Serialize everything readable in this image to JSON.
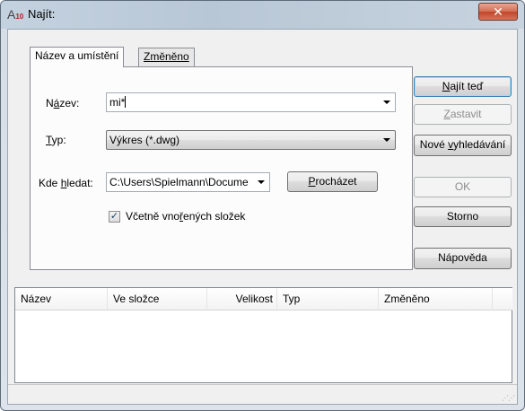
{
  "window": {
    "title": "Najít:",
    "close_glyph": "✕"
  },
  "tabs": [
    {
      "label": "Název a umístění",
      "active": true
    },
    {
      "label": "Změněno",
      "active": false
    }
  ],
  "form": {
    "name_label_pre": "N",
    "name_label_u": "á",
    "name_label_post": "zev:",
    "name_value": "mi*",
    "type_label_u": "T",
    "type_label_post": "yp:",
    "type_value": "Výkres (*.dwg)",
    "lookin_label_pre": "Kde ",
    "lookin_label_u": "h",
    "lookin_label_post": "ledat:",
    "lookin_value": "C:\\Users\\Spielmann\\Docume",
    "browse_u": "P",
    "browse_post": "rocházet",
    "subfolders_pre": "Včetně vno",
    "subfolders_u": "ř",
    "subfolders_post": "ených složek",
    "subfolders_checked": true
  },
  "buttons": {
    "find_u": "N",
    "find_post": "ajít teď",
    "stop_u": "Z",
    "stop_post": "astavit",
    "new_pre": "Nové ",
    "new_u": "v",
    "new_post": "yhledávání",
    "ok": "OK",
    "cancel": "Storno",
    "help": "Nápověda"
  },
  "results": {
    "columns": [
      "Název",
      "Ve složce",
      "Velikost",
      "Typ",
      "Změněno"
    ],
    "rows": []
  },
  "colors": {
    "title_bar": "#c4d2e0",
    "close_button": "#c0442a",
    "default_button_border": "#3c7fb1"
  }
}
